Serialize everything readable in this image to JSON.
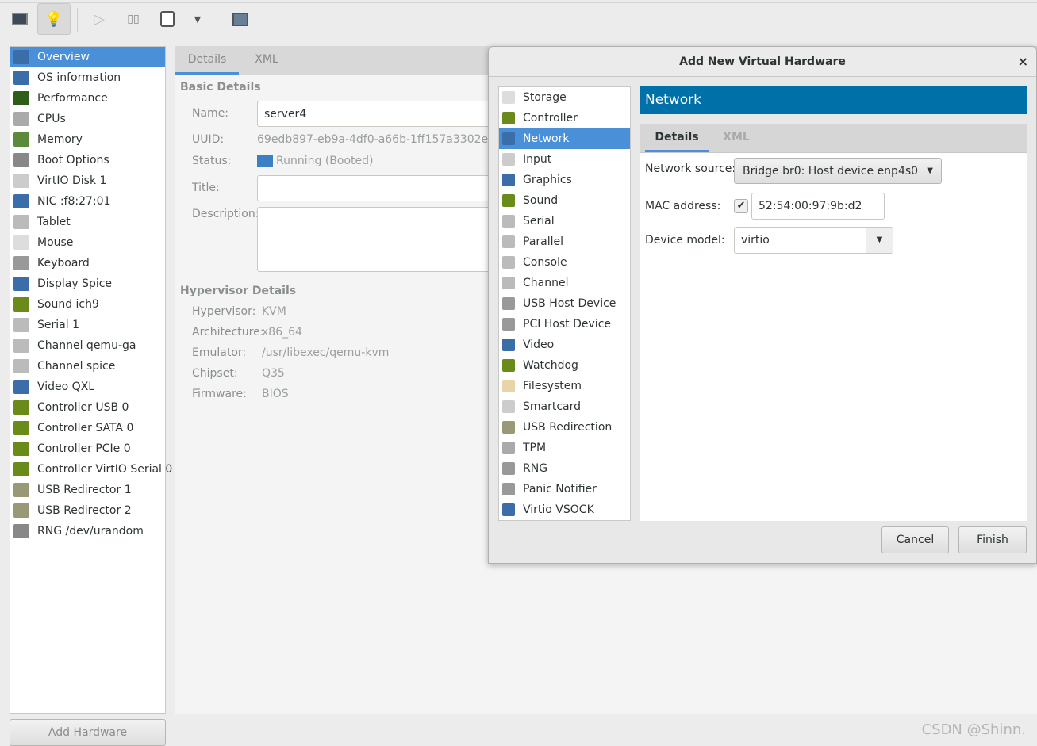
{
  "toolbar": {
    "buttons": [
      {
        "icon": "monitor-icon"
      },
      {
        "icon": "lightbulb-icon"
      },
      {
        "icon": "play-icon"
      },
      {
        "icon": "pause-icon"
      },
      {
        "icon": "power-icon"
      },
      {
        "icon": "dropdown-icon"
      },
      {
        "icon": "fullscreen-icon"
      }
    ]
  },
  "sidebar": {
    "items": [
      {
        "label": "Overview",
        "icon": "monitor-icon",
        "color": "#3b6ea8"
      },
      {
        "label": "OS information",
        "icon": "monitor-icon",
        "color": "#3b6ea8"
      },
      {
        "label": "Performance",
        "icon": "performance-icon",
        "color": "#2c5e1a"
      },
      {
        "label": "CPUs",
        "icon": "cpu-icon",
        "color": "#aaaaaa"
      },
      {
        "label": "Memory",
        "icon": "memory-icon",
        "color": "#5a8a3a"
      },
      {
        "label": "Boot Options",
        "icon": "gears-icon",
        "color": "#888888"
      },
      {
        "label": "VirtIO Disk 1",
        "icon": "disk-icon",
        "color": "#cccccc"
      },
      {
        "label": "NIC :f8:27:01",
        "icon": "network-icon",
        "color": "#3b6ea8"
      },
      {
        "label": "Tablet",
        "icon": "tablet-icon",
        "color": "#bbbbbb"
      },
      {
        "label": "Mouse",
        "icon": "mouse-icon",
        "color": "#dddddd"
      },
      {
        "label": "Keyboard",
        "icon": "keyboard-icon",
        "color": "#999999"
      },
      {
        "label": "Display Spice",
        "icon": "monitor-icon",
        "color": "#3b6ea8"
      },
      {
        "label": "Sound ich9",
        "icon": "sound-card-icon",
        "color": "#6a8a1a"
      },
      {
        "label": "Serial 1",
        "icon": "serial-icon",
        "color": "#bbbbbb"
      },
      {
        "label": "Channel qemu-ga",
        "icon": "channel-icon",
        "color": "#bbbbbb"
      },
      {
        "label": "Channel spice",
        "icon": "channel-icon",
        "color": "#bbbbbb"
      },
      {
        "label": "Video QXL",
        "icon": "monitor-icon",
        "color": "#3b6ea8"
      },
      {
        "label": "Controller USB 0",
        "icon": "controller-icon",
        "color": "#6a8a1a"
      },
      {
        "label": "Controller SATA 0",
        "icon": "controller-icon",
        "color": "#6a8a1a"
      },
      {
        "label": "Controller PCIe 0",
        "icon": "controller-icon",
        "color": "#6a8a1a"
      },
      {
        "label": "Controller VirtIO Serial 0",
        "icon": "controller-icon",
        "color": "#6a8a1a"
      },
      {
        "label": "USB Redirector 1",
        "icon": "usb-icon",
        "color": "#999977"
      },
      {
        "label": "USB Redirector 2",
        "icon": "usb-icon",
        "color": "#999977"
      },
      {
        "label": "RNG /dev/urandom",
        "icon": "gears-icon",
        "color": "#888888"
      }
    ],
    "add_hardware": "Add Hardware"
  },
  "main": {
    "tabs": [
      "Details",
      "XML"
    ],
    "basic_details": "Basic Details",
    "fields": {
      "name_label": "Name:",
      "name": "server4",
      "uuid_label": "UUID:",
      "uuid": "69edb897-eb9a-4df0-a66b-1ff157a3302e",
      "status_label": "Status:",
      "status": "Running (Booted)",
      "title_label": "Title:",
      "title": "",
      "description_label": "Description:",
      "description": ""
    },
    "hypervisor_details": "Hypervisor Details",
    "hypervisor": [
      {
        "label": "Hypervisor:",
        "value": "KVM"
      },
      {
        "label": "Architecture:",
        "value": "x86_64"
      },
      {
        "label": "Emulator:",
        "value": "/usr/libexec/qemu-kvm"
      },
      {
        "label": "Chipset:",
        "value": "Q35"
      },
      {
        "label": "Firmware:",
        "value": "BIOS"
      }
    ]
  },
  "dialog": {
    "title": "Add New Virtual Hardware",
    "close": "×",
    "items": [
      {
        "label": "Storage",
        "color": "#dddddd"
      },
      {
        "label": "Controller",
        "color": "#6a8a1a"
      },
      {
        "label": "Network",
        "color": "#3b6ea8"
      },
      {
        "label": "Input",
        "color": "#cccccc"
      },
      {
        "label": "Graphics",
        "color": "#3b6ea8"
      },
      {
        "label": "Sound",
        "color": "#6a8a1a"
      },
      {
        "label": "Serial",
        "color": "#bbbbbb"
      },
      {
        "label": "Parallel",
        "color": "#bbbbbb"
      },
      {
        "label": "Console",
        "color": "#bbbbbb"
      },
      {
        "label": "Channel",
        "color": "#bbbbbb"
      },
      {
        "label": "USB Host Device",
        "color": "#999999"
      },
      {
        "label": "PCI Host Device",
        "color": "#999999"
      },
      {
        "label": "Video",
        "color": "#3b6ea8"
      },
      {
        "label": "Watchdog",
        "color": "#6a8a1a"
      },
      {
        "label": "Filesystem",
        "color": "#e8d4a8"
      },
      {
        "label": "Smartcard",
        "color": "#cccccc"
      },
      {
        "label": "USB Redirection",
        "color": "#999977"
      },
      {
        "label": "TPM",
        "color": "#aaaaaa"
      },
      {
        "label": "RNG",
        "color": "#999999"
      },
      {
        "label": "Panic Notifier",
        "color": "#999999"
      },
      {
        "label": "Virtio VSOCK",
        "color": "#3b6ea8"
      }
    ],
    "selected": "Network",
    "header": "Network",
    "header_color": "#0071a8",
    "tabs": [
      "Details",
      "XML"
    ],
    "network_source_label": "Network source:",
    "network_source": "Bridge br0: Host device enp4s0",
    "mac_label": "MAC address:",
    "mac_checked": true,
    "mac": "52:54:00:97:9b:d2",
    "device_model_label": "Device model:",
    "device_model": "virtio",
    "cancel": "Cancel",
    "finish": "Finish"
  },
  "watermark": "CSDN @Shinn."
}
